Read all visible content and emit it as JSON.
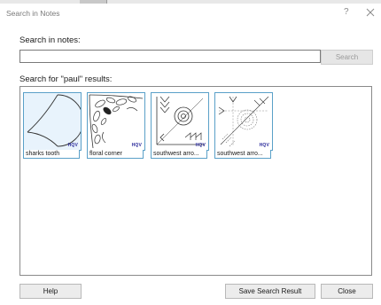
{
  "window": {
    "title": "Search in Notes",
    "help_glyph": "?"
  },
  "search": {
    "label": "Search in notes:",
    "value": "",
    "placeholder": "",
    "button_label": "Search"
  },
  "results": {
    "label": "Search for \"paul\" results:",
    "items": [
      {
        "name": "sharks tooth",
        "icon": "sharks-tooth-pattern",
        "badge": "HQV",
        "selected": true
      },
      {
        "name": "floral corner",
        "icon": "floral-corner-pattern",
        "badge": "HQV",
        "selected": false
      },
      {
        "name": "southwest arro...",
        "icon": "southwest-arrow-pattern",
        "badge": "HQV",
        "selected": false
      },
      {
        "name": "southwest arro...",
        "icon": "southwest-arrow-pattern-2",
        "badge": "HQV",
        "selected": false
      }
    ]
  },
  "footer": {
    "help_label": "Help",
    "save_label": "Save Search Result",
    "close_label": "Close"
  },
  "colors": {
    "thumb_border": "#5aa0c8",
    "thumb_selected_bg": "#e8f3fc",
    "badge": "#2a2a9a"
  }
}
